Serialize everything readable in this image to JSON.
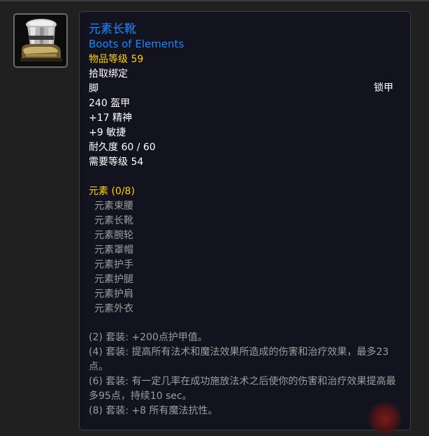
{
  "item": {
    "icon": "mail-boots-icon",
    "name_cn": "元素长靴",
    "name_en": "Boots of Elements",
    "item_level": "物品等级 59",
    "binding": "拾取绑定",
    "slot": "脚",
    "armor_type": "锁甲",
    "armor": "240 盔甲",
    "stats": [
      "+17 精神",
      "+9 敏捷"
    ],
    "durability": "耐久度 60 / 60",
    "required_level": "需要等级 54"
  },
  "set": {
    "title": "元素 (0/8)",
    "pieces": [
      "元素束腰",
      "元素长靴",
      "元素腕轮",
      "元素罩帽",
      "元素护手",
      "元素护腿",
      "元素护肩",
      "元素外衣"
    ],
    "bonuses": [
      "(2) 套装: +200点护甲值。",
      "(4) 套装: 提高所有法术和魔法效果所造成的伤害和治疗效果，最多23点。",
      "(6) 套装: 有一定几率在成功施放法术之后使你的伤害和治疗效果提高最多95点，持续10 sec。",
      "(8) 套装: +8 所有魔法抗性。"
    ]
  },
  "colors": {
    "name": "#1a88ff",
    "gold": "#ffd200",
    "white": "#ffffff",
    "inactive_set": "#9d9d9d"
  }
}
